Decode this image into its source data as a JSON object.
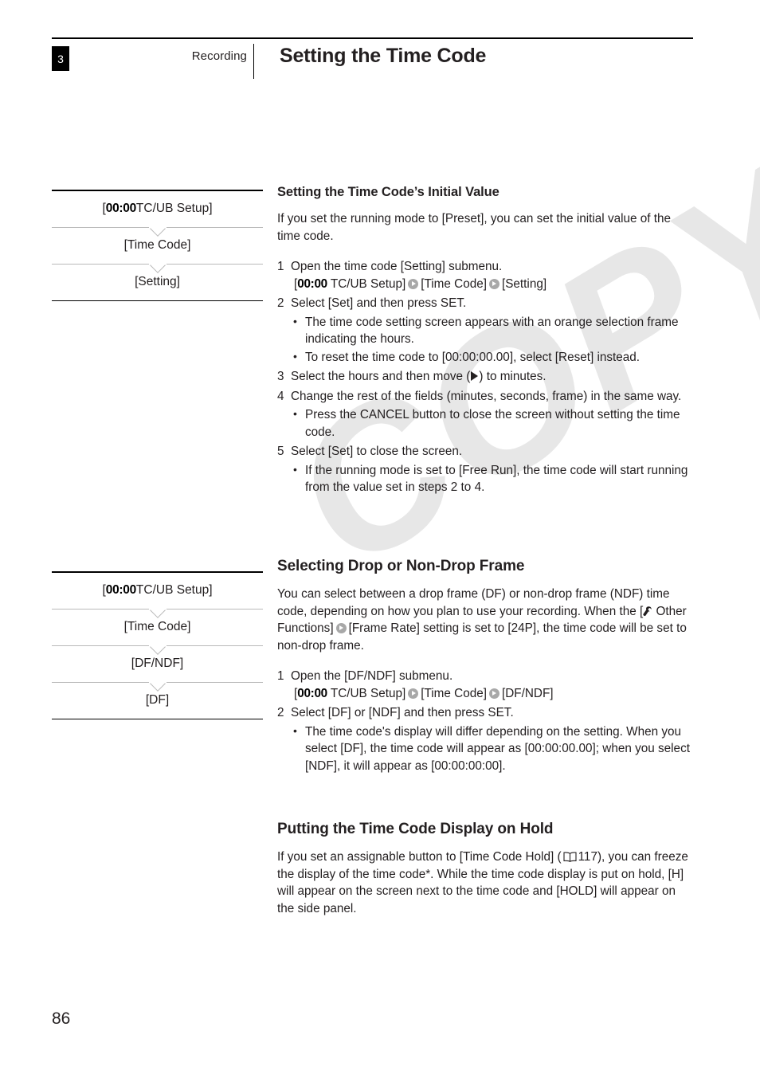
{
  "header": {
    "chapter": "3",
    "section": "Recording",
    "title": "Setting the Time Code"
  },
  "watermark": {
    "text": "COPY"
  },
  "menu_paths": [
    {
      "name": "time-code-setting-path",
      "rows": [
        {
          "icon_text": "00:00",
          "label": " TC/UB Setup]",
          "prefix": "["
        },
        {
          "label": "[Time Code]"
        },
        {
          "label": "[Setting]"
        }
      ]
    },
    {
      "name": "df-ndf-path",
      "rows": [
        {
          "icon_text": "00:00",
          "label": " TC/UB Setup]",
          "prefix": "["
        },
        {
          "label": "[Time Code]"
        },
        {
          "label": "[DF/NDF]"
        },
        {
          "label": "[DF]"
        }
      ]
    }
  ],
  "sections": {
    "initial_value": {
      "heading": "Setting the Time Code’s Initial Value",
      "intro": "If you set the running mode to [Preset], you can set the initial value of the time code.",
      "step1": {
        "num": "1",
        "text": "Open the time code [Setting] submenu.",
        "path_prefix": "[",
        "path_icon": "00:00",
        "path_part1": " TC/UB Setup]",
        "path_part2": "[Time Code]",
        "path_part3": "[Setting]"
      },
      "step2": {
        "num": "2",
        "text": "Select [Set] and then press SET.",
        "bullets": [
          "The time code setting screen appears with an orange selection frame indicating the hours.",
          "To reset the time code to [00:00:00.00], select [Reset] instead."
        ]
      },
      "step3": {
        "num": "3",
        "text_before": "Select the hours and then move (",
        "text_after": ") to minutes."
      },
      "step4": {
        "num": "4",
        "text": "Change the rest of the fields (minutes, seconds, frame) in the same way.",
        "bullets": [
          "Press the CANCEL button to close the screen without setting the time code."
        ]
      },
      "step5": {
        "num": "5",
        "text": "Select [Set] to close the screen.",
        "bullets": [
          "If the running mode is set to [Free Run], the time code will start running from the value set in steps 2 to 4."
        ]
      }
    },
    "drop_frame": {
      "heading": "Selecting Drop or Non-Drop Frame",
      "intro_part1": "You can select between a drop frame (DF) or non-drop frame (NDF) time code, depending on how you plan to use your recording. When the [",
      "intro_menu1": " Other Functions]",
      "intro_menu2": "[Frame Rate]",
      "intro_part2": " setting is set to [24P], the time code will be set to non-drop frame.",
      "step1": {
        "num": "1",
        "text": "Open the [DF/NDF] submenu.",
        "path_prefix": "[",
        "path_icon": "00:00",
        "path_part1": " TC/UB Setup]",
        "path_part2": "[Time Code]",
        "path_part3": "[DF/NDF]"
      },
      "step2": {
        "num": "2",
        "text": "Select [DF] or [NDF] and then press SET.",
        "bullets": [
          "The time code's display will differ depending on the setting. When you select [DF], the time code will appear as [00:00:00.00]; when you select [NDF], it will appear as [00:00:00:00]."
        ]
      }
    },
    "hold": {
      "heading": "Putting the Time Code Display on Hold",
      "text_part1": "If you set an assignable button to [Time Code Hold] (",
      "page_ref": "117",
      "text_part2": "), you can freeze the display of the time code*. While the time code display is put on hold, [H] will appear on the screen next to the time code and [HOLD] will appear on the side panel."
    }
  },
  "footer": {
    "page_number": "86"
  }
}
